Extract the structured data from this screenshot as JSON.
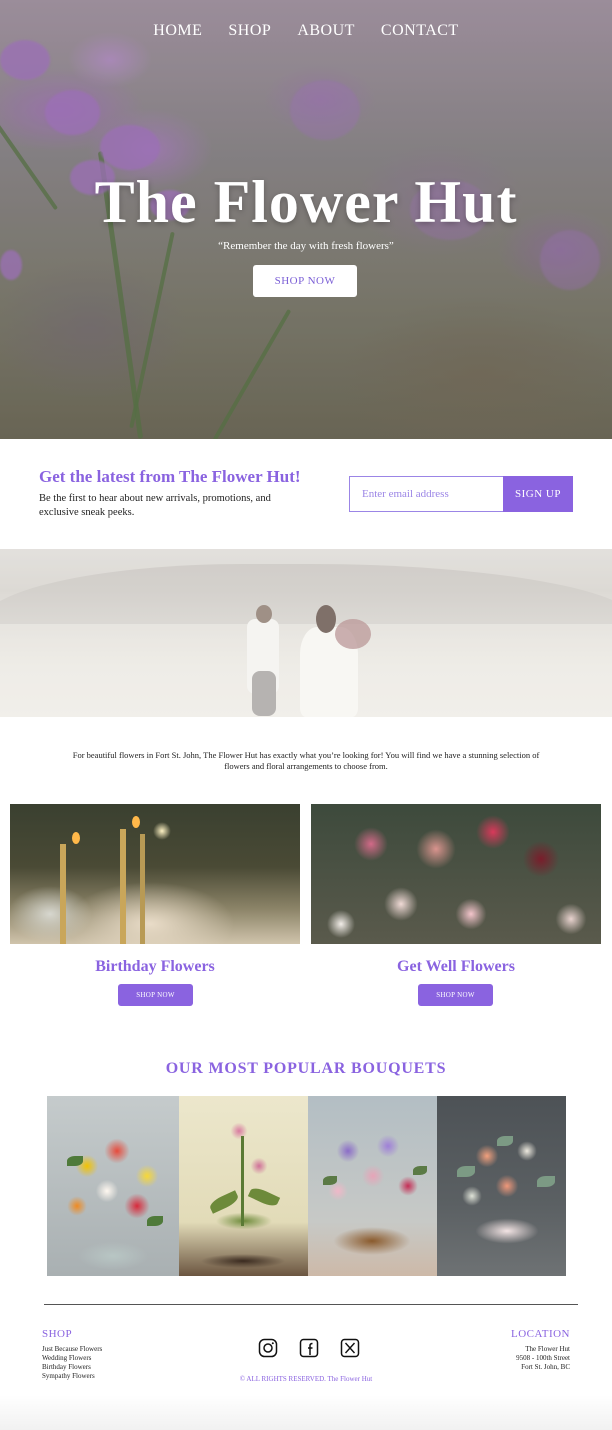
{
  "nav": {
    "items": [
      {
        "label": "HOME"
      },
      {
        "label": "SHOP"
      },
      {
        "label": "ABOUT"
      },
      {
        "label": "CONTACT"
      }
    ]
  },
  "hero": {
    "title": "The Flower Hut",
    "tagline": "“Remember the day with fresh flowers”",
    "cta_label": "SHOP NOW",
    "image_icon": "purple-flowers-photo"
  },
  "newsletter": {
    "title": "Get the latest from The Flower Hut!",
    "description": "Be the first to hear about new arrivals, promotions, and exclusive sneak peeks.",
    "email_placeholder": "Enter email address",
    "signup_label": "SIGN UP"
  },
  "banner": {
    "image_icon": "couple-walking-photo"
  },
  "intro": {
    "text": "For beautiful flowers in Fort St. John, The Flower Hut has exactly what you’re looking for! You will find we have a stunning selection of flowers and floral arrangements to choose from."
  },
  "categories": [
    {
      "title": "Birthday Flowers",
      "button_label": "SHOP NOW",
      "image_icon": "birthday-candles-photo"
    },
    {
      "title": "Get Well Flowers",
      "button_label": "SHOP NOW",
      "image_icon": "roses-bouquet-photo"
    }
  ],
  "popular": {
    "title": "OUR MOST POPULAR BOUQUETS",
    "items": [
      {
        "image_icon": "mixed-bouquet-photo"
      },
      {
        "image_icon": "lily-arrangement-photo"
      },
      {
        "image_icon": "basket-bouquet-photo"
      },
      {
        "image_icon": "peach-box-bouquet-photo"
      }
    ]
  },
  "footer": {
    "shop_heading": "SHOP",
    "shop_links": [
      "Just Because Flowers",
      "Wedding Flowers",
      "Birthday Flowers",
      "Sympathy Flowers"
    ],
    "location_heading": "LOCATION",
    "location_lines": [
      "The Flower Hut",
      "9508 - 100th Street",
      "Fort St. John, BC"
    ],
    "social_icons": [
      "instagram-icon",
      "facebook-icon",
      "x-twitter-icon"
    ],
    "copyright": "© ALL RIGHTS RESERVED. The Flower Hut"
  },
  "colors": {
    "accent": "#8a63e0",
    "white": "#ffffff",
    "text": "#222222"
  }
}
